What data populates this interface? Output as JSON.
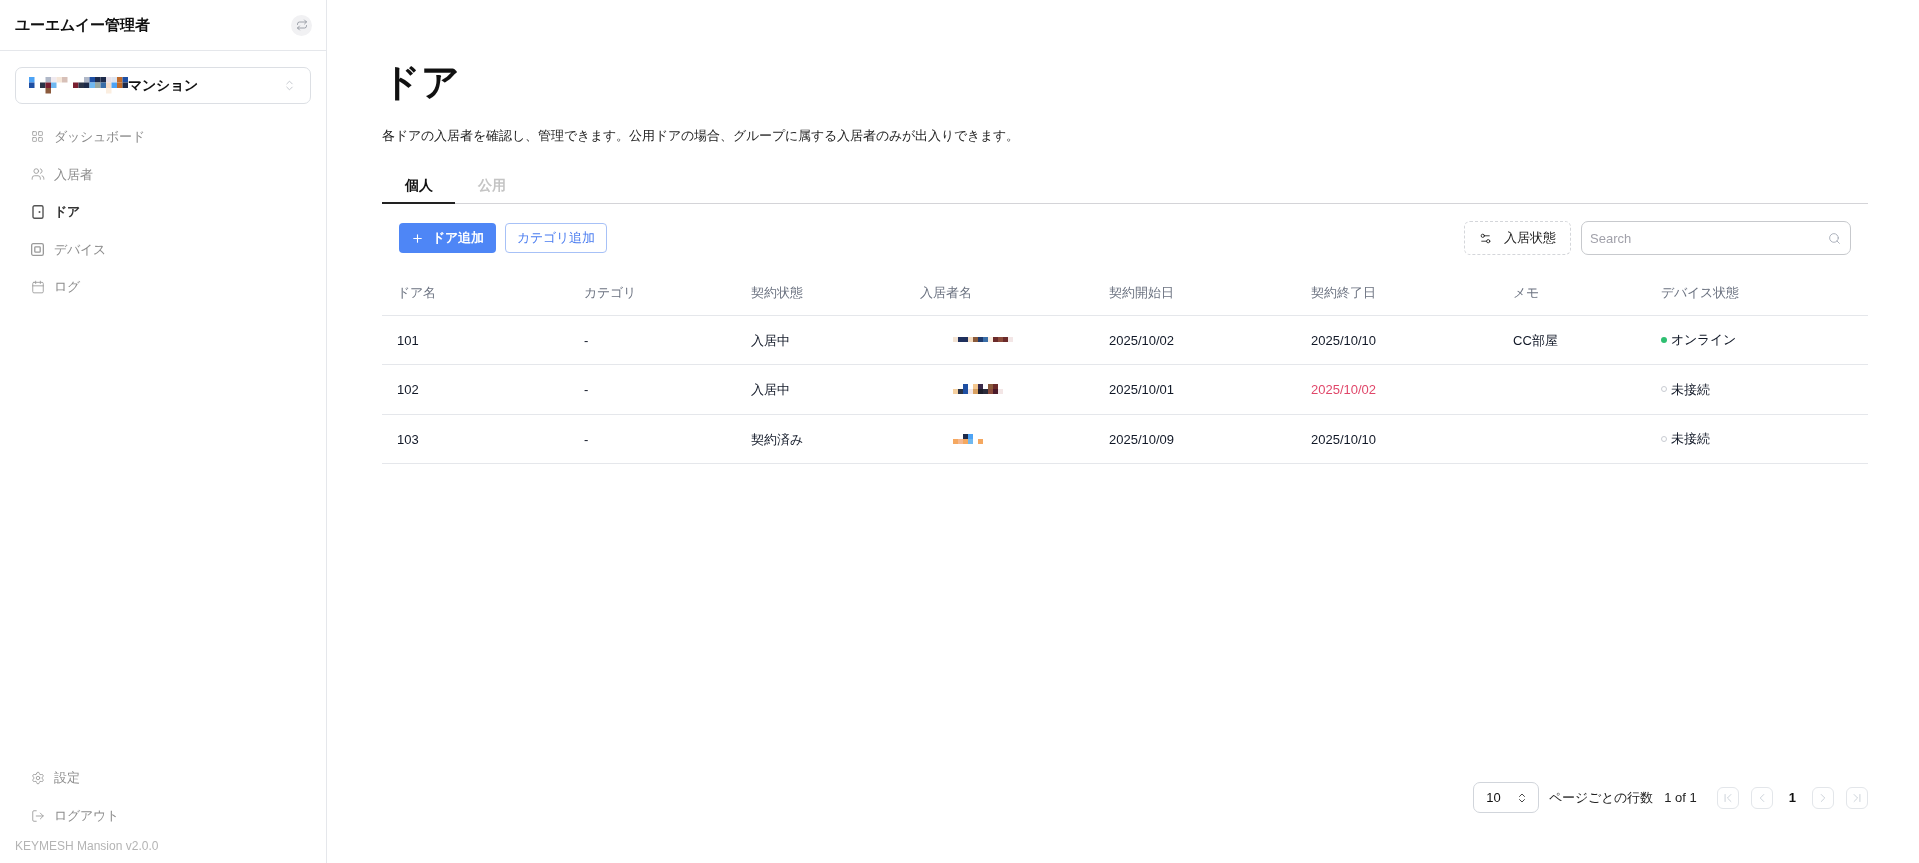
{
  "sidebar": {
    "title": "ユーエムイー管理者",
    "building_select": {
      "value": "マンション",
      "prefix_pixelated": true
    },
    "nav": [
      {
        "label": "ダッシュボード",
        "selected": false
      },
      {
        "label": "入居者",
        "selected": false
      },
      {
        "label": "ドア",
        "selected": true
      },
      {
        "label": "デバイス",
        "selected": false
      },
      {
        "label": "ログ",
        "selected": false
      }
    ],
    "footer_nav": [
      {
        "label": "設定"
      },
      {
        "label": "ログアウト"
      }
    ],
    "version": "KEYMESH Mansion v2.0.0"
  },
  "page": {
    "title": "ドア",
    "description": "各ドアの入居者を確認し、管理できます。公用ドアの場合、グループに属する入居者のみが出入りできます。"
  },
  "tabs": [
    {
      "label": "個人",
      "selected": true
    },
    {
      "label": "公用",
      "selected": false
    }
  ],
  "toolbar": {
    "buttons": [
      {
        "label": "ドア追加",
        "kind": "primary"
      },
      {
        "label": "カテゴリ追加",
        "kind": "outline"
      }
    ],
    "filter": {
      "label": "入居状態"
    },
    "search": {
      "placeholder": "Search"
    }
  },
  "table": {
    "columns": [
      "ドア名",
      "カテゴリ",
      "契約状態",
      "入居者名",
      "契約開始日",
      "契約終了日",
      "メモ",
      "デバイス状態"
    ],
    "rows": [
      {
        "door": "101",
        "category": "-",
        "contract_status": "入居中",
        "resident_pixelated": true,
        "start_date": "2025/10/02",
        "end_date": "2025/10/10",
        "end_date_warning": false,
        "memo": "CC部屋",
        "device_status": "オンライン",
        "online": true
      },
      {
        "door": "102",
        "category": "-",
        "contract_status": "入居中",
        "resident_pixelated": true,
        "start_date": "2025/10/01",
        "end_date": "2025/10/02",
        "end_date_warning": true,
        "device_status": "未接続",
        "online": false
      },
      {
        "door": "103",
        "category": "-",
        "contract_status": "契約済み",
        "resident_pixelated": true,
        "start_date": "2025/10/09",
        "end_date": "2025/10/10",
        "end_date_warning": false,
        "device_status": "未接続",
        "online": false
      }
    ]
  },
  "pagination": {
    "page_size": "10",
    "page_size_label": "ページごとの行数",
    "page_info": "1 of 1",
    "current_page": "1",
    "nav_buttons": [
      {
        "disabled": true
      },
      {
        "disabled": true
      },
      {
        "disabled": true
      },
      {
        "disabled": true
      }
    ]
  }
}
